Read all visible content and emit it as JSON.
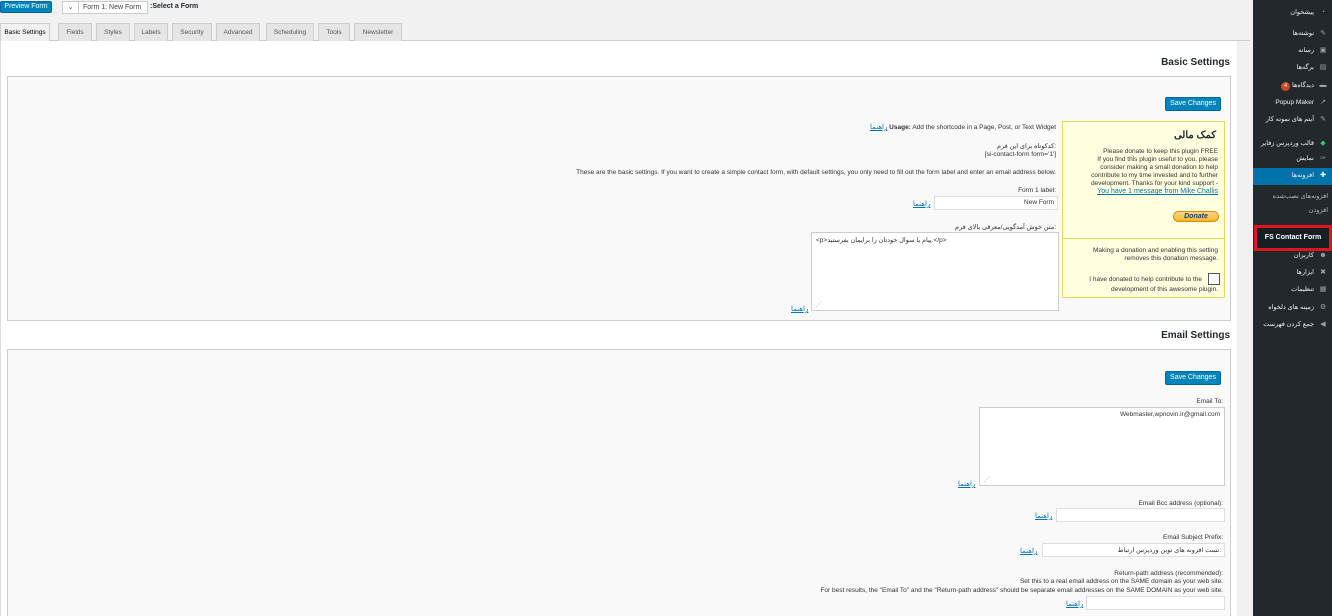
{
  "toolbar": {
    "preview_label": "Preview Form",
    "form_select_value": "Form 1: New Form",
    "select_form_label": ":Select a Form"
  },
  "tabs": [
    {
      "label": "Basic Settings"
    },
    {
      "label": "Fields"
    },
    {
      "label": "Styles"
    },
    {
      "label": "Labels"
    },
    {
      "label": "Security"
    },
    {
      "label": "Advanced"
    },
    {
      "label": "Scheduling"
    },
    {
      "label": "Tools"
    },
    {
      "label": "Newsletter"
    }
  ],
  "basic": {
    "title": "Basic Settings",
    "save_label": "Save Changes",
    "usage_help": "راهنما",
    "usage_bold": "Usage:",
    "usage_text": "Add the shortcode in a Page, Post, or Text Widget",
    "shortcode_label": "کدکوتاه برای این فرم:",
    "shortcode_value": "[si-contact-form form='1']",
    "intro_text": "These are the basic settings. If you want to create a simple contact form, with default settings, you only need to fill out the form label and enter an email address below.",
    "form_label_label": "Form 1 label:",
    "form_label_value": "New Form",
    "form_label_help": "راهنما",
    "welcome_label": "متن خوش آمدگویی/معرفی بالای فرم:",
    "welcome_value": "<p>پیام یا سوال خودتان را برایمان بفرستید.</p>",
    "welcome_help": "راهنما"
  },
  "donate": {
    "title": "کمک مالی",
    "line1": "Please donate to keep this plugin FREE",
    "line2": "If you find this plugin useful to you, please",
    "line3": "consider making a small donation to help",
    "line4": "contribute to my time invested and to further",
    "line5": "development. Thanks for your kind support -",
    "message_link": "You have 1 message from Mike Challis",
    "button": "Donate",
    "note1": "Making a donation and enabling this setting",
    "note2": "removes this donation message.",
    "check1": "I have donated to help contribute to the",
    "check2": "development of this awesome plugin."
  },
  "email": {
    "title": "Email Settings",
    "save_label": "Save Changes",
    "email_to_label": "Email To:",
    "email_to_value": "Webmaster,wpnovin.ir@gmail.com",
    "email_to_help": "راهنما",
    "bcc_label": "Email Bcc address (optional):",
    "bcc_value": "",
    "bcc_help": "راهنما",
    "subject_label": "Email Subject Prefix:",
    "subject_value": "تست افزونه های نوین وردپرس ارتباط:",
    "subject_help": "راهنما",
    "return_label": "Return-path address (recommended):",
    "return_line1": "Set this to a real email address on the SAME domain as your web site.",
    "return_line2": "For best results, the \"Email To\" and the \"Return-path address\" should be separate email addresses on the SAME DOMAIN as your web site.",
    "return_value": "",
    "return_help": "راهنما"
  },
  "sidebar": {
    "items": [
      {
        "label": "پیشخوان",
        "icon": "dashboard-icon"
      },
      {
        "label": "نوشته‌ها",
        "icon": "pin-icon"
      },
      {
        "label": "رسانه",
        "icon": "media-icon"
      },
      {
        "label": "برگه‌ها",
        "icon": "page-icon"
      },
      {
        "label": "دیدگاه‌ها",
        "icon": "comment-icon",
        "badge": "4"
      },
      {
        "label": "Popup Maker",
        "icon": "popup-icon"
      },
      {
        "label": "آیتم های نمونه کار",
        "icon": "pin-icon"
      },
      {
        "label": "قالب وردپرس زفایر",
        "icon": "diamond-icon"
      },
      {
        "label": "نمایش",
        "icon": "brush-icon"
      },
      {
        "label": "افزونه‌ها",
        "icon": "plugin-icon"
      }
    ],
    "submenu": [
      "افزونه‌های نصب‌شده",
      "افزودن"
    ],
    "fs_contact": "FS Contact Form",
    "items_after": [
      {
        "label": "کاربران",
        "icon": "users-icon"
      },
      {
        "label": "ابزارها",
        "icon": "tools-icon"
      },
      {
        "label": "تنظیمات",
        "icon": "settings-icon"
      },
      {
        "label": "زمینه های دلخواه",
        "icon": "gear-icon"
      },
      {
        "label": "جمع کردن فهرست",
        "icon": "collapse-icon"
      }
    ]
  }
}
